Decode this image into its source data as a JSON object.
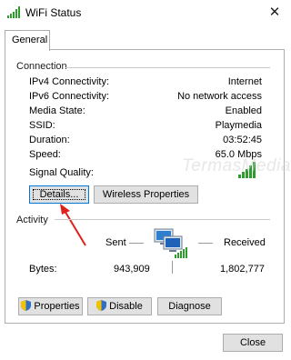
{
  "window": {
    "title": "WiFi Status",
    "close_glyph": "✕"
  },
  "tabs": [
    {
      "label": "General"
    }
  ],
  "connection": {
    "group_title": "Connection",
    "rows": [
      {
        "label": "IPv4 Connectivity:",
        "value": "Internet"
      },
      {
        "label": "IPv6 Connectivity:",
        "value": "No network access"
      },
      {
        "label": "Media State:",
        "value": "Enabled"
      },
      {
        "label": "SSID:",
        "value": "Playmedia"
      },
      {
        "label": "Duration:",
        "value": "03:52:45"
      },
      {
        "label": "Speed:",
        "value": "65.0 Mbps"
      }
    ],
    "signal_label": "Signal Quality:",
    "signal_bars": 5,
    "details_button": "Details...",
    "wireless_button": "Wireless Properties"
  },
  "activity": {
    "group_title": "Activity",
    "sent_label": "Sent",
    "received_label": "Received",
    "bytes_label": "Bytes:",
    "bytes_sent": "943,909",
    "bytes_received": "1,802,777"
  },
  "buttons": {
    "properties": "Properties",
    "disable": "Disable",
    "diagnose": "Diagnose",
    "close": "Close"
  },
  "watermark": "TermasMedia",
  "colors": {
    "signal_green": "#2e9d2e",
    "focus_blue": "#0078d7",
    "annotation_red": "#e0201b"
  }
}
